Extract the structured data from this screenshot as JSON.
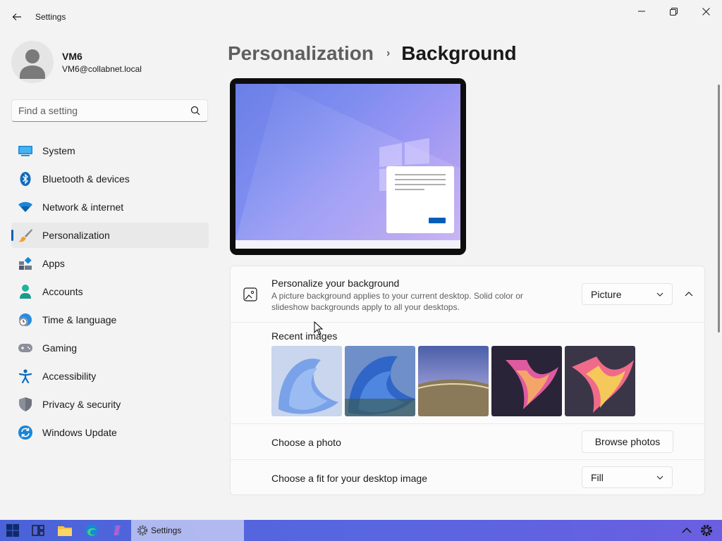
{
  "window": {
    "title": "Settings",
    "controls": [
      "minimize",
      "maximize",
      "close"
    ]
  },
  "user": {
    "name": "VM6",
    "email": "VM6@collabnet.local"
  },
  "search": {
    "placeholder": "Find a setting"
  },
  "sidebar": {
    "items": [
      {
        "label": "System",
        "icon": "system-icon"
      },
      {
        "label": "Bluetooth & devices",
        "icon": "bluetooth-icon"
      },
      {
        "label": "Network & internet",
        "icon": "wifi-icon"
      },
      {
        "label": "Personalization",
        "icon": "brush-icon",
        "selected": true
      },
      {
        "label": "Apps",
        "icon": "apps-icon"
      },
      {
        "label": "Accounts",
        "icon": "person-icon"
      },
      {
        "label": "Time & language",
        "icon": "globe-clock-icon"
      },
      {
        "label": "Gaming",
        "icon": "gamepad-icon"
      },
      {
        "label": "Accessibility",
        "icon": "accessibility-icon"
      },
      {
        "label": "Privacy & security",
        "icon": "shield-icon"
      },
      {
        "label": "Windows Update",
        "icon": "update-icon"
      }
    ]
  },
  "breadcrumb": {
    "parent": "Personalization",
    "separator": "›",
    "current": "Background"
  },
  "background": {
    "title": "Personalize your background",
    "description": "A picture background applies to your current desktop. Solid color or slideshow backgrounds apply to all your desktops.",
    "type_value": "Picture",
    "recent_images_label": "Recent images",
    "choose_photo_label": "Choose a photo",
    "browse_button": "Browse photos",
    "fit_label": "Choose a fit for your desktop image",
    "fit_value": "Fill"
  },
  "taskbar": {
    "active_app": "Settings",
    "icons": [
      "start-icon",
      "task-view-icon",
      "file-explorer-icon",
      "edge-icon",
      "copilot-icon",
      "settings-icon"
    ]
  },
  "colors": {
    "accent": "#005fb8",
    "window_bg": "#f3f3f3",
    "card_bg": "#fbfbfb"
  }
}
